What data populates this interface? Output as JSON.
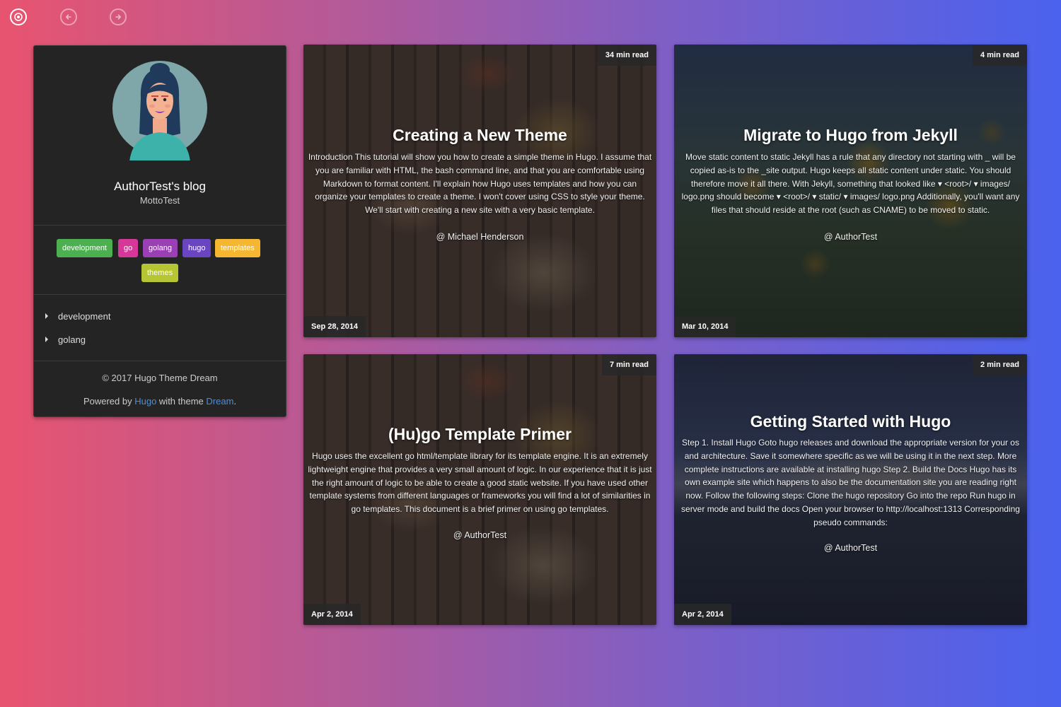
{
  "nav": {
    "home_icon": "target-icon",
    "back_icon": "arrow-left-circle-icon",
    "forward_icon": "arrow-right-circle-icon"
  },
  "sidebar": {
    "avatar_icon": "avatar-woman-illustration",
    "title": "AuthorTest's blog",
    "motto": "MottoTest",
    "tags": [
      {
        "label": "development",
        "color": "#4caf50"
      },
      {
        "label": "go",
        "color": "#d6389a"
      },
      {
        "label": "golang",
        "color": "#9b3fb5"
      },
      {
        "label": "hugo",
        "color": "#6a45c2"
      },
      {
        "label": "templates",
        "color": "#f5b731"
      },
      {
        "label": "themes",
        "color": "#b6c534"
      }
    ],
    "categories": [
      {
        "label": "development"
      },
      {
        "label": "golang"
      }
    ],
    "copyright": "© 2017 Hugo Theme Dream",
    "powered": {
      "prefix": "Powered by",
      "hugo_link": "Hugo",
      "middle": "with theme",
      "dream_link": "Dream",
      "suffix": "."
    }
  },
  "posts": [
    {
      "read_time": "34 min read",
      "title": "Creating a New Theme",
      "summary": "Introduction This tutorial will show you how to create a simple theme in Hugo. I assume that you are familiar with HTML, the bash command line, and that you are comfortable using Markdown to format content. I'll explain how Hugo uses templates and how you can organize your templates to create a theme. I won't cover using CSS to style your theme. We'll start with creating a new site with a very basic template.",
      "author": "@ Michael Henderson",
      "date": "Sep 28, 2014"
    },
    {
      "read_time": "4 min read",
      "title": "Migrate to Hugo from Jekyll",
      "summary": "Move static content to static Jekyll has a rule that any directory not starting with _ will be copied as-is to the _site output. Hugo keeps all static content under static. You should therefore move it all there. With Jekyll, something that looked like ▾ <root>/ ▾ images/ logo.png should become ▾ <root>/ ▾ static/ ▾ images/ logo.png Additionally, you'll want any files that should reside at the root (such as CNAME) to be moved to static.",
      "author": "@ AuthorTest",
      "date": "Mar 10, 2014"
    },
    {
      "read_time": "7 min read",
      "title": "(Hu)go Template Primer",
      "summary": "Hugo uses the excellent go html/template library for its template engine. It is an extremely lightweight engine that provides a very small amount of logic. In our experience that it is just the right amount of logic to be able to create a good static website. If you have used other template systems from different languages or frameworks you will find a lot of similarities in go templates. This document is a brief primer on using go templates.",
      "author": "@ AuthorTest",
      "date": "Apr 2, 2014"
    },
    {
      "read_time": "2 min read",
      "title": "Getting Started with Hugo",
      "summary": "Step 1. Install Hugo Goto hugo releases and download the appropriate version for your os and architecture. Save it somewhere specific as we will be using it in the next step. More complete instructions are available at installing hugo Step 2. Build the Docs Hugo has its own example site which happens to also be the documentation site you are reading right now. Follow the following steps: Clone the hugo repository Go into the repo Run hugo in server mode and build the docs Open your browser to http://localhost:1313 Corresponding pseudo commands:",
      "author": "@ AuthorTest",
      "date": "Apr 2, 2014"
    }
  ]
}
